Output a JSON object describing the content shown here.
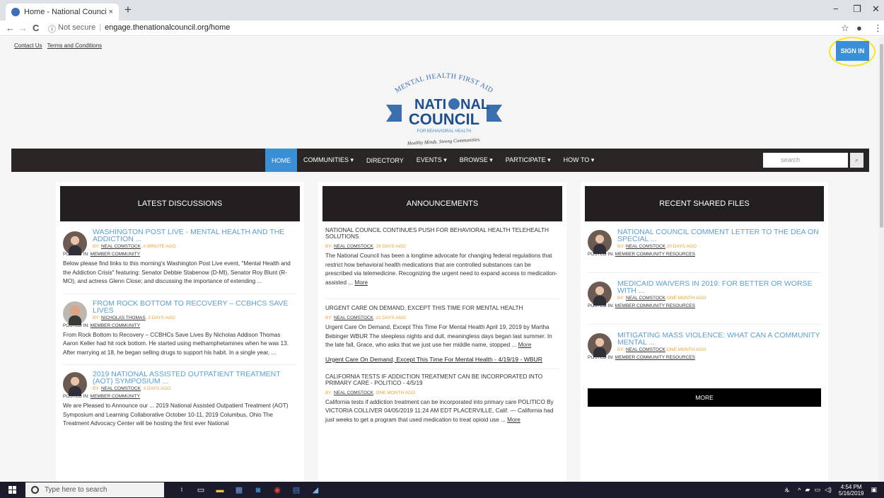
{
  "browser": {
    "tab_title": "Home - National Council for Beh",
    "tab_close": "×",
    "new_tab": "+",
    "not_secure": "Not secure",
    "url": "engage.thenationalcouncil.org/home",
    "back": "←",
    "forward": "→",
    "reload": "C",
    "info": "ⓘ",
    "star": "☆",
    "menu": "⋮",
    "account": "●",
    "minimize": "−",
    "maximize": "❐",
    "close": "✕"
  },
  "header": {
    "contact_us": "Contact Us",
    "terms": "Terms and Conditions",
    "sign_in": "SIGN IN"
  },
  "logo": {
    "top_arc": "MENTAL HEALTH FIRST AID",
    "line1": "NATI",
    "line1b": "NAL",
    "line2": "COUNCIL",
    "sub": "FOR BEHAVIORAL HEALTH",
    "tagline": "Healthy Minds. Strong Communities."
  },
  "nav": {
    "items": [
      {
        "label": "HOME",
        "active": true
      },
      {
        "label": "COMMUNITIES ▾"
      },
      {
        "label": "DIRECTORY"
      },
      {
        "label": "EVENTS ▾"
      },
      {
        "label": "BROWSE ▾"
      },
      {
        "label": "PARTICIPATE ▾"
      },
      {
        "label": "HOW TO ▾"
      }
    ],
    "search_placeholder": "search",
    "search_icon": "⌕"
  },
  "discussions": {
    "heading": "LATEST DISCUSSIONS",
    "posted_in_label": "POSTED IN:",
    "items": [
      {
        "title": "WASHINGTON POST LIVE - MENTAL HEALTH AND THE ADDICTION ...",
        "by": "BY:",
        "author": "NEAL COMSTOCK",
        "time": ", A MINUTE AGO",
        "posted_in": "MEMBER COMMUNITY",
        "excerpt": "Below please find links to this morning's Washington Post Live event, \"Mental Health and the Addiction Crisis\" featuring:  Senator Debbie Stabenow (D-MI), Senator Roy Blunt (R-MO), and actress Glenn Close; and discussing the importance of extending ..."
      },
      {
        "title": "FROM ROCK BOTTOM TO RECOVERY – CCBHCS SAVE LIVES",
        "by": "BY:",
        "author": "NICHOLAS THOMAS",
        "time": ", 2 DAYS AGO",
        "posted_in": "MEMBER COMMUNITY",
        "excerpt": "From Rock Bottom to Recovery – CCBHCs Save Lives By Nicholas Addison Thomas Aaron Keller had hit rock bottom. He started using methamphetamines when he was 13. After marrying at 18, he began selling drugs to support his habit. In a single year, ..."
      },
      {
        "title": "2019 NATIONAL ASSISTED OUTPATIENT TREATMENT (AOT) SYMPOSIUM ...",
        "by": "BY:",
        "author": "NEAL COMSTOCK",
        "time": ", 3 DAYS AGO",
        "posted_in": "MEMBER COMMUNITY",
        "excerpt": "We are Pleased to Announce our ... 2019 National Assisted Outpatient Treatment (AOT) Symposium and Learning Collaborative  October 10-11, 2019 Columbus, Ohio  The Treatment Advocacy Center will be hosting the first ever National"
      }
    ]
  },
  "announcements": {
    "heading": "ANNOUNCEMENTS",
    "more_label": "More",
    "items": [
      {
        "title": "NATIONAL COUNCIL CONTINUES PUSH FOR BEHAVIORAL HEALTH TELEHEALTH SOLUTIONS",
        "by": "BY:",
        "author": "NEAL COMSTOCK",
        "time": ", 28 DAYS AGO",
        "excerpt": "The National Council has been a longtime advocate for changing federal regulations that restrict how behavioral health medications that are controlled substances can be prescribed via telemedicine. Recognizing the urgent need to expand access to medication-assisted ..."
      },
      {
        "title": "URGENT CARE ON DEMAND, EXCEPT THIS TIME FOR MENTAL HEALTH",
        "by": "BY:",
        "author": "NEAL COMSTOCK",
        "time": ", 21 DAYS AGO",
        "excerpt": "Urgent Care On Demand, Except This Time For Mental Health April 19, 2019  by Martha Bebinger WBUR   The sleepless nights and dull, meaningless days began last summer. In the late fall, Grace, who asks that we just use her middle name, stopped ...",
        "link": "Urgent Care On Demand, Except This Time For Mental Health - 4/19/19 - WBUR"
      },
      {
        "title": "CALIFORNIA TESTS IF ADDICTION TREATMENT CAN BE INCORPORATED INTO PRIMARY CARE - POLITICO - 4/5/19",
        "by": "BY:",
        "author": "NEAL COMSTOCK",
        "time": ", ONE MONTH AGO",
        "excerpt": "California tests if addiction treatment can be incorporated into primary care POLITICO By VICTORIA COLLIVER 04/05/2019 11:24 AM EDT PLACERVILLE, Calif. — California had just weeks to get a program that used medication to treat opioid use ..."
      }
    ]
  },
  "files": {
    "heading": "RECENT SHARED FILES",
    "posted_in_label": "POSTED IN:",
    "more_button": "MORE",
    "items": [
      {
        "title": "NATIONAL COUNCIL COMMENT LETTER TO THE DEA ON SPECIAL ...",
        "by": "BY:",
        "author": "NEAL COMSTOCK",
        "time": " 20 DAYS AGO",
        "posted_in": "MEMBER COMMUNITY RESOURCES"
      },
      {
        "title": "MEDICAID WAIVERS IN 2019: FOR BETTER OR WORSE WITH ...",
        "by": "BY:",
        "author": "NEAL COMSTOCK",
        "time": " ONE MONTH AGO",
        "posted_in": "MEMBER COMMUNITY RESOURCES"
      },
      {
        "title": "MITIGATING MASS VIOLENCE: WHAT CAN A COMMUNITY MENTAL ...",
        "by": "BY:",
        "author": "NEAL COMSTOCK",
        "time": " ONE MONTH AGO",
        "posted_in": "MEMBER COMMUNITY RESOURCES"
      }
    ]
  },
  "taskbar": {
    "search_placeholder": "Type here to search",
    "time": "4:54 PM",
    "date": "5/16/2019"
  },
  "colors": {
    "accent": "#3b8fd6",
    "title_blue": "#5a9fd6",
    "time_orange": "#f0a030",
    "dark_header": "#231f20",
    "highlight_circle": "#f5e71c"
  }
}
